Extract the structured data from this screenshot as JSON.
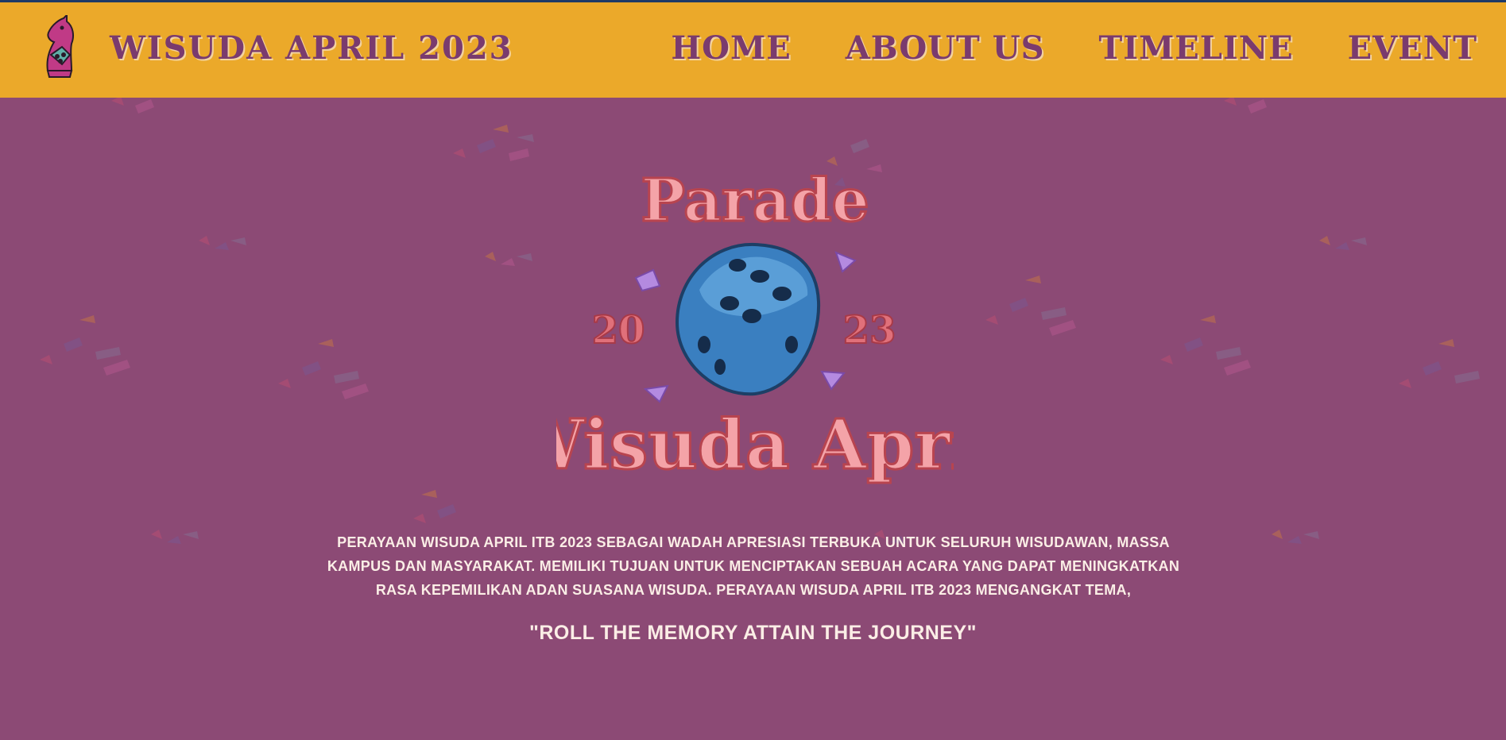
{
  "header": {
    "site_title": "WISUDA APRIL 2023",
    "nav": [
      {
        "label": "HOME"
      },
      {
        "label": "ABOUT US"
      },
      {
        "label": "TIMELINE"
      },
      {
        "label": "EVENT"
      }
    ]
  },
  "hero": {
    "logo_top_text": "Parade",
    "year_left": "20",
    "year_right": "23",
    "logo_bottom_text": "Wisuda April"
  },
  "main": {
    "description": "PERAYAAN WISUDA APRIL ITB 2023 SEBAGAI WADAH APRESIASI TERBUKA UNTUK SELURUH WISUDAWAN, MASSA KAMPUS DAN MASYARAKAT. MEMILIKI TUJUAN UNTUK MENCIPTAKAN SEBUAH ACARA YANG DAPAT MENINGKATKAN RASA KEPEMILIKAN ADAN SUASANA WISUDA. PERAYAAN WISUDA APRIL ITB 2023 MENGANGKAT TEMA,",
    "tagline": "\"ROLL THE MEMORY ATTAIN THE JOURNEY\""
  },
  "colors": {
    "header_bg": "#eba92a",
    "page_bg": "#8c4a75",
    "nav_text": "#7a3b6e",
    "logo_pink": "#c8505f",
    "dice_blue": "#3a7fc0"
  },
  "icons": {
    "logo": "chess-knight-icon",
    "dice": "dice-icon"
  }
}
